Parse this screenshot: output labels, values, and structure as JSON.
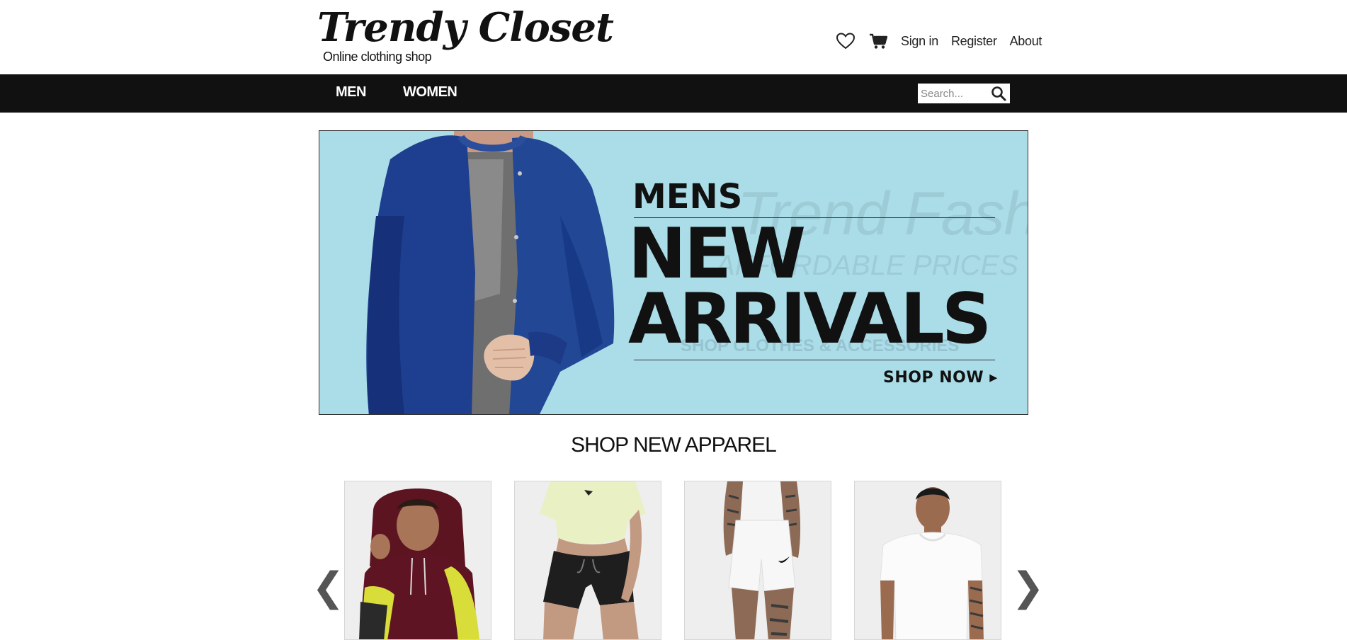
{
  "header": {
    "logo": "Trendy Closet",
    "tagline": "Online clothing shop",
    "icons": [
      "heart-icon",
      "cart-icon"
    ],
    "links": {
      "sign_in": "Sign in",
      "register": "Register",
      "about": "About"
    }
  },
  "nav": {
    "items": [
      {
        "label": "MEN"
      },
      {
        "label": "WOMEN"
      }
    ],
    "search": {
      "placeholder": "Search...",
      "icon": "search-icon"
    }
  },
  "banner": {
    "kicker": "MENS",
    "headline_line1": "NEW",
    "headline_line2": "ARRIVALS",
    "cta": "SHOP NOW ▸",
    "background_color": "#aadde8"
  },
  "section": {
    "title": "SHOP NEW APPAREL"
  },
  "carousel": {
    "prev": "❮",
    "next": "❯",
    "products": [
      {
        "name": "maroon-hoodie"
      },
      {
        "name": "women-shorts-outfit"
      },
      {
        "name": "white-shorts"
      },
      {
        "name": "white-tshirt"
      }
    ]
  },
  "colors": {
    "nav_background": "#111111",
    "accent": "#1c3f8f"
  }
}
